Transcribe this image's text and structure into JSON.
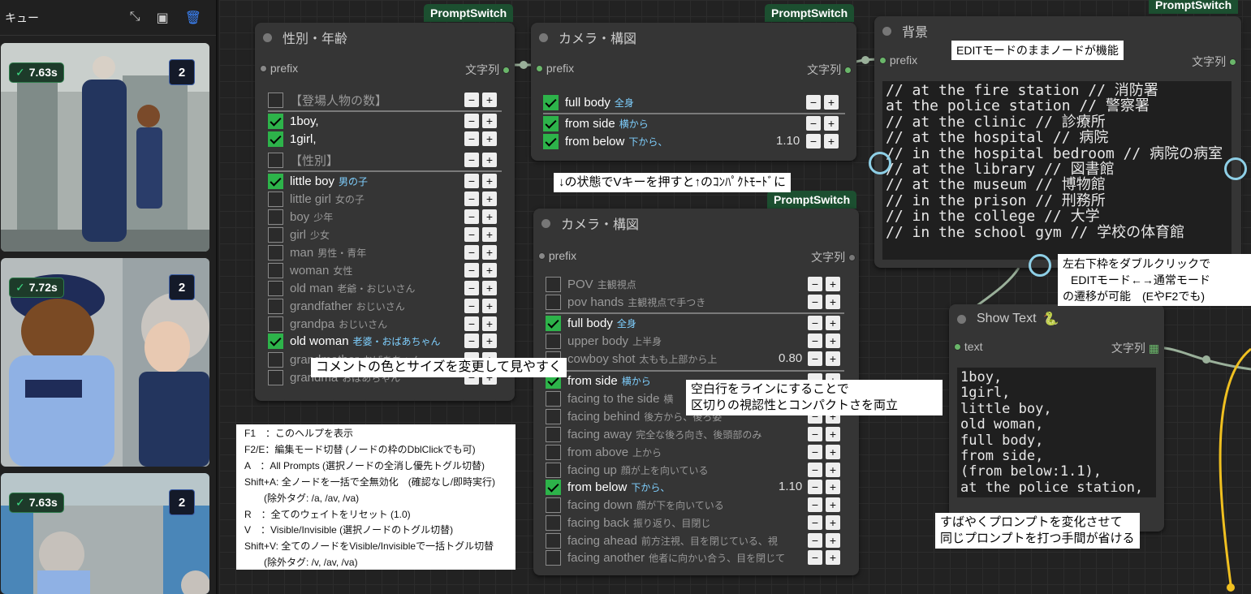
{
  "queue": {
    "title": "キュー",
    "items": [
      {
        "time": "7.63s",
        "count": "2"
      },
      {
        "time": "7.72s",
        "count": "2"
      },
      {
        "time": "7.63s",
        "count": "2"
      }
    ]
  },
  "canvas": {
    "tags": {
      "switch": "PromptSwitch"
    },
    "node_gender": {
      "title": "性別・年齢",
      "in_port": "prefix",
      "out_port": "文字列",
      "rows": [
        {
          "label": "【登場人物の数】",
          "jp": "",
          "on": false
        },
        {
          "label": "1boy,",
          "jp": "",
          "on": true
        },
        {
          "label": "1girl,",
          "jp": "",
          "on": true
        },
        {
          "label": "【性別】",
          "jp": "",
          "on": false
        },
        {
          "label": "little boy",
          "jp": "男の子",
          "on": true
        },
        {
          "label": "little girl",
          "jp": "女の子",
          "on": false
        },
        {
          "label": "boy",
          "jp": "少年",
          "on": false
        },
        {
          "label": "girl",
          "jp": "少女",
          "on": false
        },
        {
          "label": "man",
          "jp": "男性・青年",
          "on": false
        },
        {
          "label": "woman",
          "jp": "女性",
          "on": false
        },
        {
          "label": "old man",
          "jp": "老爺・おじいさん",
          "on": false
        },
        {
          "label": "grandfather",
          "jp": "おじいさん",
          "on": false
        },
        {
          "label": "grandpa",
          "jp": "おじいさん",
          "on": false
        },
        {
          "label": "old woman",
          "jp": "老婆・おばあちゃん",
          "on": true
        },
        {
          "label": "grandmother",
          "jp": "おばあちゃん",
          "on": false
        },
        {
          "label": "grandma",
          "jp": "おばあちゃん",
          "on": false
        }
      ]
    },
    "node_camera_small": {
      "title": "カメラ・構図",
      "in_port": "prefix",
      "out_port": "文字列",
      "rows": [
        {
          "label": "full body",
          "jp": "全身",
          "on": true,
          "val": ""
        },
        {
          "label": "from side",
          "jp": "横から",
          "on": true,
          "val": ""
        },
        {
          "label": "from below",
          "jp": "下から、",
          "on": true,
          "val": "1.10"
        }
      ]
    },
    "node_background": {
      "title": "背景",
      "in_port": "prefix",
      "out_port": "文字列",
      "text": "// at the fire station // 消防署\nat the police station // 警察署\n// at the clinic // 診療所\n// at the hospital // 病院\n// in the hospital bedroom // 病院の病室\n// at the library // 図書館\n// at the museum // 博物館\n// in the prison // 刑務所\n// in the college // 大学\n// in the school gym // 学校の体育館"
    },
    "node_camera_big": {
      "title": "カメラ・構図",
      "in_port": "prefix",
      "out_port": "文字列",
      "rows": [
        {
          "label": "POV",
          "jp": "主観視点",
          "on": false,
          "val": ""
        },
        {
          "label": "pov hands",
          "jp": "主観視点で手つき",
          "on": false,
          "val": ""
        },
        {
          "label": "full body",
          "jp": "全身",
          "on": true,
          "val": ""
        },
        {
          "label": "upper body",
          "jp": "上半身",
          "on": false,
          "val": ""
        },
        {
          "label": "cowboy shot",
          "jp": "太もも上部から上",
          "on": false,
          "val": "0.80"
        },
        {
          "label": "from side",
          "jp": "横から",
          "on": true,
          "val": ""
        },
        {
          "label": "facing to the side",
          "jp": "横",
          "on": false,
          "val": ""
        },
        {
          "label": "facing behind",
          "jp": "後方から、後ろ姿",
          "on": false,
          "val": ""
        },
        {
          "label": "facing away",
          "jp": "完全な後ろ向き、後頭部のみ",
          "on": false,
          "val": ""
        },
        {
          "label": "from above",
          "jp": "上から",
          "on": false,
          "val": ""
        },
        {
          "label": "facing up",
          "jp": "顔が上を向いている",
          "on": false,
          "val": ""
        },
        {
          "label": "from below",
          "jp": "下から、",
          "on": true,
          "val": "1.10"
        },
        {
          "label": "facing down",
          "jp": "顔が下を向いている",
          "on": false,
          "val": ""
        },
        {
          "label": "facing back",
          "jp": "振り返り、目閉じ",
          "on": false,
          "val": ""
        },
        {
          "label": "facing ahead",
          "jp": "前方注視、目を閉じている、視",
          "on": false,
          "val": ""
        },
        {
          "label": "facing another",
          "jp": "他者に向かい合う、目を閉じて",
          "on": false,
          "val": ""
        }
      ]
    },
    "node_show_text": {
      "title": "Show Text",
      "port": "text",
      "out_port": "文字列",
      "text": "1boy,\n1girl,\nlittle boy,\nold woman,\nfull body,\nfrom side,\n(from below:1.1),\nat the police station,"
    },
    "notes": {
      "edit_mode": "EDITモードのままノードが機能",
      "compact": "↓の状態でVキーを押すと↑のｺﾝﾊﾟｸﾄﾓｰﾄﾞに",
      "comment": "コメントの色とサイズを変更して見やすく",
      "blank_line_1": "空白行をラインにすることで",
      "blank_line_2": "区切りの視認性とコンパクトさを両立",
      "dblclick_1": "左右下枠をダブルクリックで",
      "dblclick_2": "EDITモード←→通常モード",
      "dblclick_3": "の遷移が可能　(EやF2でも)",
      "quick_1": "すばやくプロンプトを変化させて",
      "quick_2": "同じプロンプトを打つ手間が省ける"
    },
    "help": [
      "F1　：このヘルプを表示",
      "F2/E：編集モード切替 (ノードの枠のDblClickでも可)",
      "A　：All Prompts (選択ノードの全消し優先トグル切替)",
      "Shift+A: 全ノードを一括で全無効化　(確認なし/即時実行)",
      "　　(除外タグ: /a, /av, /va)",
      "R　：全てのウェイトをリセット (1.0)",
      "V　：Visible/Invisible (選択ノードのトグル切替)",
      "Shift+V: 全てのノードをVisible/Invisibleで一括トグル切替",
      "　　(除外タグ: /v, /av, /va)"
    ]
  }
}
